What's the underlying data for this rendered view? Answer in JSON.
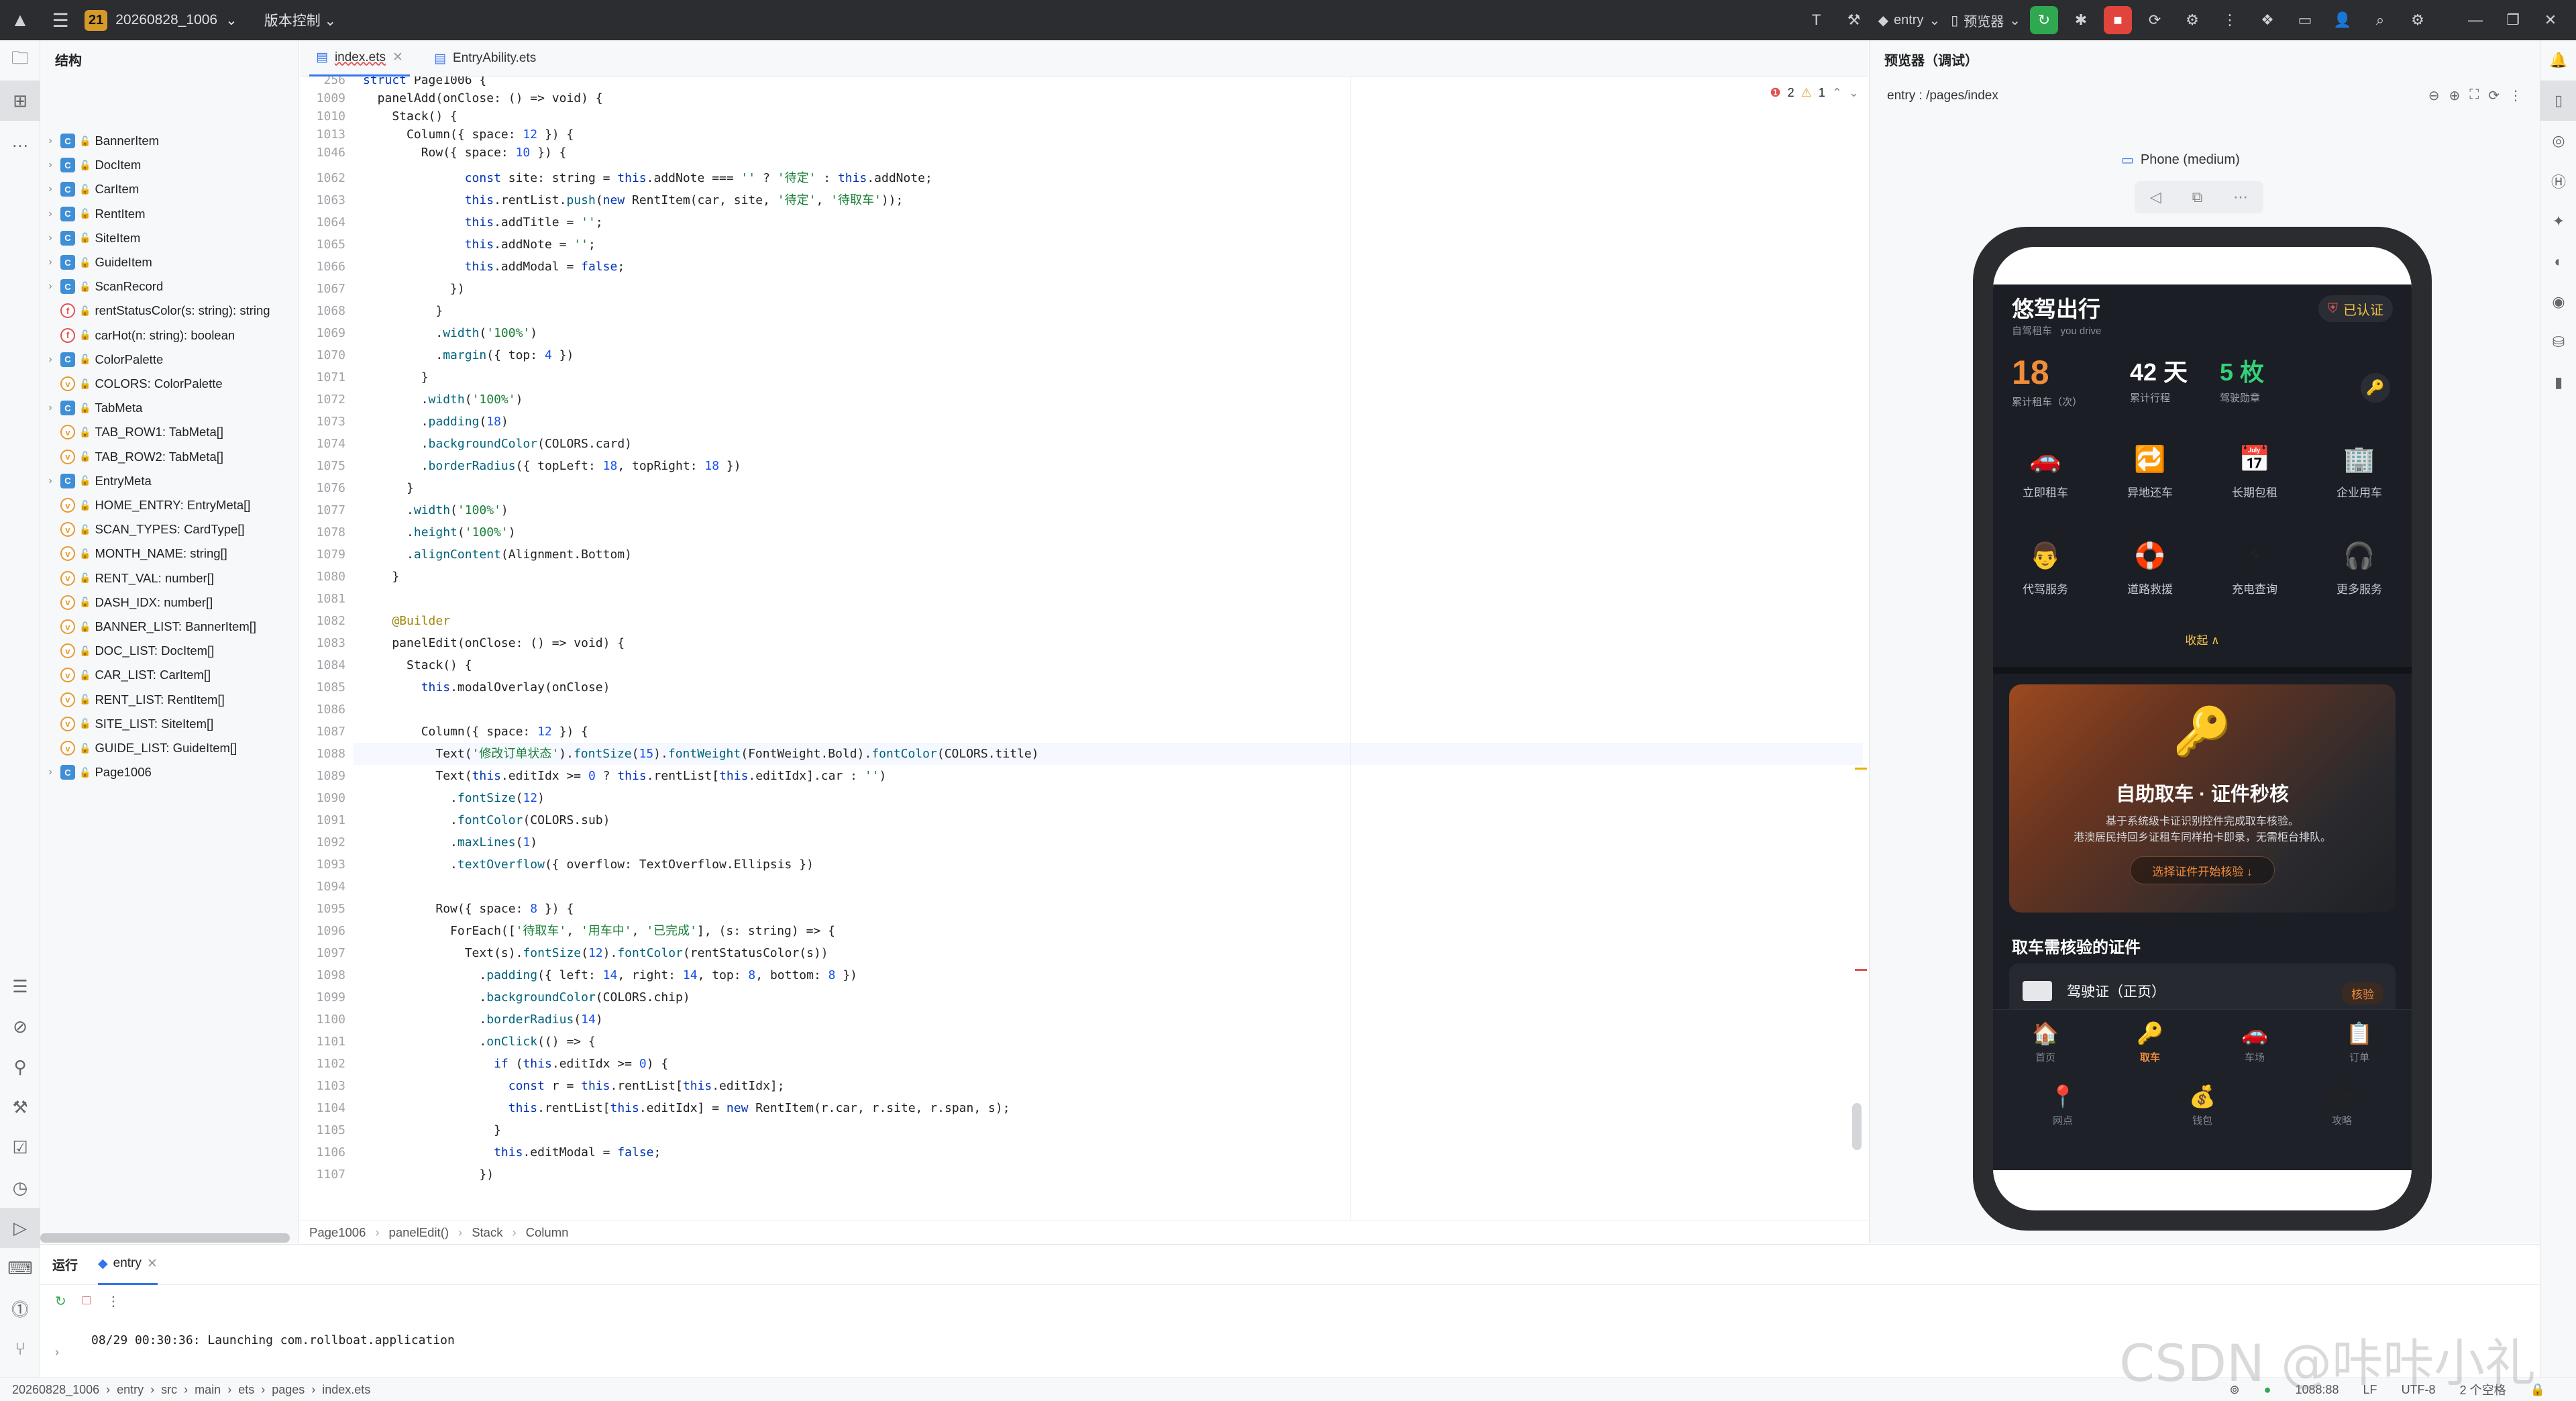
{
  "titlebar": {
    "project_num": "21",
    "project_name": "20260828_1006",
    "vcs": "版本控制",
    "run_config": "entry",
    "device": "预览器"
  },
  "structure": {
    "header": "结构",
    "items": [
      {
        "label": "BannerItem",
        "kind": "class",
        "expandable": true
      },
      {
        "label": "DocItem",
        "kind": "class",
        "expandable": true
      },
      {
        "label": "CarItem",
        "kind": "class",
        "expandable": true
      },
      {
        "label": "RentItem",
        "kind": "class",
        "expandable": true
      },
      {
        "label": "SiteItem",
        "kind": "class",
        "expandable": true
      },
      {
        "label": "GuideItem",
        "kind": "class",
        "expandable": true
      },
      {
        "label": "ScanRecord",
        "kind": "class",
        "expandable": true
      },
      {
        "label": "rentStatusColor(s: string): string",
        "kind": "func",
        "expandable": false
      },
      {
        "label": "carHot(n: string): boolean",
        "kind": "func",
        "expandable": false
      },
      {
        "label": "ColorPalette",
        "kind": "class",
        "expandable": true
      },
      {
        "label": "COLORS: ColorPalette",
        "kind": "var",
        "expandable": false
      },
      {
        "label": "TabMeta",
        "kind": "class",
        "expandable": true
      },
      {
        "label": "TAB_ROW1: TabMeta[]",
        "kind": "var",
        "expandable": false
      },
      {
        "label": "TAB_ROW2: TabMeta[]",
        "kind": "var",
        "expandable": false
      },
      {
        "label": "EntryMeta",
        "kind": "class",
        "expandable": true
      },
      {
        "label": "HOME_ENTRY: EntryMeta[]",
        "kind": "var",
        "expandable": false
      },
      {
        "label": "SCAN_TYPES: CardType[]",
        "kind": "var",
        "expandable": false
      },
      {
        "label": "MONTH_NAME: string[]",
        "kind": "var",
        "expandable": false
      },
      {
        "label": "RENT_VAL: number[]",
        "kind": "var",
        "expandable": false
      },
      {
        "label": "DASH_IDX: number[]",
        "kind": "var",
        "expandable": false
      },
      {
        "label": "BANNER_LIST: BannerItem[]",
        "kind": "var",
        "expandable": false
      },
      {
        "label": "DOC_LIST: DocItem[]",
        "kind": "var",
        "expandable": false
      },
      {
        "label": "CAR_LIST: CarItem[]",
        "kind": "var",
        "expandable": false
      },
      {
        "label": "RENT_LIST: RentItem[]",
        "kind": "var",
        "expandable": false
      },
      {
        "label": "SITE_LIST: SiteItem[]",
        "kind": "var",
        "expandable": false
      },
      {
        "label": "GUIDE_LIST: GuideItem[]",
        "kind": "var",
        "expandable": false
      },
      {
        "label": "Page1006",
        "kind": "class",
        "expandable": true
      }
    ]
  },
  "tabs": [
    {
      "label": "index.ets",
      "active": true
    },
    {
      "label": "EntryAbility.ets",
      "active": false
    }
  ],
  "editor": {
    "errors": "2",
    "warnings": "1",
    "sticky": [
      {
        "ln": "256",
        "code": "struct Page1006 {"
      },
      {
        "ln": "1009",
        "code": "  panelAdd(onClose: () => void) {"
      },
      {
        "ln": "1010",
        "code": "    Stack() {"
      },
      {
        "ln": "1013",
        "code": "      Column({ space: 12 }) {"
      },
      {
        "ln": "1046",
        "code": "        Row({ space: 10 }) {"
      }
    ],
    "lines": [
      {
        "ln": "1062",
        "code": "              const site: string = this.addNote === '' ? '待定' : this.addNote;"
      },
      {
        "ln": "1063",
        "code": "              this.rentList.push(new RentItem(car, site, '待定', '待取车'));"
      },
      {
        "ln": "1064",
        "code": "              this.addTitle = '';"
      },
      {
        "ln": "1065",
        "code": "              this.addNote = '';"
      },
      {
        "ln": "1066",
        "code": "              this.addModal = false;"
      },
      {
        "ln": "1067",
        "code": "            })"
      },
      {
        "ln": "1068",
        "code": "          }"
      },
      {
        "ln": "1069",
        "code": "          .width('100%')"
      },
      {
        "ln": "1070",
        "code": "          .margin({ top: 4 })"
      },
      {
        "ln": "1071",
        "code": "        }"
      },
      {
        "ln": "1072",
        "code": "        .width('100%')"
      },
      {
        "ln": "1073",
        "code": "        .padding(18)"
      },
      {
        "ln": "1074",
        "code": "        .backgroundColor(COLORS.card)"
      },
      {
        "ln": "1075",
        "code": "        .borderRadius({ topLeft: 18, topRight: 18 })"
      },
      {
        "ln": "1076",
        "code": "      }"
      },
      {
        "ln": "1077",
        "code": "      .width('100%')"
      },
      {
        "ln": "1078",
        "code": "      .height('100%')"
      },
      {
        "ln": "1079",
        "code": "      .alignContent(Alignment.Bottom)"
      },
      {
        "ln": "1080",
        "code": "    }"
      },
      {
        "ln": "1081",
        "code": ""
      },
      {
        "ln": "1082",
        "code": "    @Builder"
      },
      {
        "ln": "1083",
        "code": "    panelEdit(onClose: () => void) {"
      },
      {
        "ln": "1084",
        "code": "      Stack() {"
      },
      {
        "ln": "1085",
        "code": "        this.modalOverlay(onClose)"
      },
      {
        "ln": "1086",
        "code": ""
      },
      {
        "ln": "1087",
        "code": "        Column({ space: 12 }) {"
      },
      {
        "ln": "1088",
        "code": "          Text('修改订单状态').fontSize(15).fontWeight(FontWeight.Bold).fontColor(COLORS.title)"
      },
      {
        "ln": "1089",
        "code": "          Text(this.editIdx >= 0 ? this.rentList[this.editIdx].car : '')"
      },
      {
        "ln": "1090",
        "code": "            .fontSize(12)"
      },
      {
        "ln": "1091",
        "code": "            .fontColor(COLORS.sub)"
      },
      {
        "ln": "1092",
        "code": "            .maxLines(1)"
      },
      {
        "ln": "1093",
        "code": "            .textOverflow({ overflow: TextOverflow.Ellipsis })"
      },
      {
        "ln": "1094",
        "code": ""
      },
      {
        "ln": "1095",
        "code": "          Row({ space: 8 }) {"
      },
      {
        "ln": "1096",
        "code": "            ForEach(['待取车', '用车中', '已完成'], (s: string) => {"
      },
      {
        "ln": "1097",
        "code": "              Text(s).fontSize(12).fontColor(rentStatusColor(s))"
      },
      {
        "ln": "1098",
        "code": "                .padding({ left: 14, right: 14, top: 8, bottom: 8 })"
      },
      {
        "ln": "1099",
        "code": "                .backgroundColor(COLORS.chip)"
      },
      {
        "ln": "1100",
        "code": "                .borderRadius(14)"
      },
      {
        "ln": "1101",
        "code": "                .onClick(() => {"
      },
      {
        "ln": "1102",
        "code": "                  if (this.editIdx >= 0) {"
      },
      {
        "ln": "1103",
        "code": "                    const r = this.rentList[this.editIdx];"
      },
      {
        "ln": "1104",
        "code": "                    this.rentList[this.editIdx] = new RentItem(r.car, r.site, r.span, s);"
      },
      {
        "ln": "1105",
        "code": "                  }"
      },
      {
        "ln": "1106",
        "code": "                  this.editModal = false;"
      },
      {
        "ln": "1107",
        "code": "                })"
      }
    ]
  },
  "breadcrumb": [
    "Page1006",
    "panelEdit()",
    "Stack",
    "Column"
  ],
  "preview": {
    "header": "预览器（调试）",
    "route": "entry : /pages/index",
    "device": "Phone (medium)",
    "app": {
      "title": "悠驾出行",
      "subtitle1": "自驾租车",
      "subtitle2": "you drive",
      "verified": "已认证",
      "stats": [
        {
          "value": "18",
          "label": "累计租车（次）",
          "color": "#f08c3a"
        },
        {
          "value": "42 天",
          "label": "累计行程",
          "color": "#ffffff"
        },
        {
          "value": "5 枚",
          "label": "驾驶勋章",
          "color": "#34d17a"
        }
      ],
      "grid1": [
        {
          "icon": "🚗",
          "label": "立即租车"
        },
        {
          "icon": "🔁",
          "label": "异地还车"
        },
        {
          "icon": "📅",
          "label": "长期包租"
        },
        {
          "icon": "🏢",
          "label": "企业用车"
        }
      ],
      "grid2": [
        {
          "icon": "👨",
          "label": "代驾服务"
        },
        {
          "icon": "🛟",
          "label": "道路救援"
        },
        {
          "icon": "⚡",
          "label": "充电查询"
        },
        {
          "icon": "🎧",
          "label": "更多服务"
        }
      ],
      "collapse": "收起 ∧",
      "banner": {
        "title": "自助取车 · 证件秒核",
        "desc1": "基于系统级卡证识别控件完成取车核验。",
        "desc2": "港澳居民持回乡证租车同样拍卡即录，无需柜台排队。",
        "button": "选择证件开始核验 ↓"
      },
      "section": "取车需核验的证件",
      "doc": {
        "name": "驾驶证（正页）",
        "action": "核验"
      },
      "nav1": [
        {
          "icon": "🏠",
          "label": "首页"
        },
        {
          "icon": "🔑",
          "label": "取车",
          "active": true
        },
        {
          "icon": "🚗",
          "label": "车场"
        },
        {
          "icon": "📋",
          "label": "订单"
        }
      ],
      "nav2": [
        {
          "icon": "📍",
          "label": "网点"
        },
        {
          "icon": "💰",
          "label": "钱包"
        },
        {
          "icon": "🗺",
          "label": "攻略"
        }
      ]
    }
  },
  "run": {
    "tab_label": "运行",
    "config": "entry",
    "log": "08/29 00:30:36: Launching com.rollboat.application"
  },
  "status": {
    "path": [
      "20260828_1006",
      "entry",
      "src",
      "main",
      "ets",
      "pages",
      "index.ets"
    ],
    "pos": "1088:88",
    "eol": "LF",
    "enc": "UTF-8",
    "indent": "2 个空格"
  },
  "watermark": "CSDN @咔咔小礼"
}
